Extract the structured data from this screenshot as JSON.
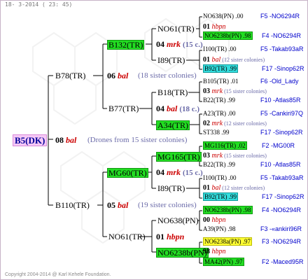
{
  "header": "18- 3-2014 ( 23: 45)",
  "footer": "Copyright 2004-2014 @ Karl Kehele Foundation.",
  "root": {
    "name": "B5(DK)",
    "num": "08",
    "breeder": "bal",
    "note": "(Drones from 15 sister colonies)"
  },
  "g1": {
    "top": "B78(TR)",
    "bottom": "B110(TR)"
  },
  "p_b78": {
    "num": "06",
    "breeder": "bal",
    "note": "(18 sister colonies)"
  },
  "p_b110": {
    "num": "05",
    "breeder": "bal",
    "note": "(19 sister colonies)"
  },
  "g2": {
    "a": "B132(TR)",
    "b": "B77(TR)",
    "c": "MG60(TR)",
    "d": "NO61(TR)"
  },
  "p_b132": {
    "num": "04",
    "breeder": "mrk",
    "note": "(15 c.)"
  },
  "p_b77": {
    "num": "04",
    "breeder": "bal",
    "note": "(18 c.)"
  },
  "p_mg60": {
    "num": "04",
    "breeder": "mrk",
    "note": "(15 c.)"
  },
  "p_no61": {
    "num": "01",
    "breeder": "hbpn"
  },
  "g3": {
    "a": "NO61(TR)",
    "b": "I89(TR)",
    "c": "B18(TR)",
    "d": "A34(TR)",
    "e": "MG165(TR)",
    "f": "I89(TR)",
    "g": "NO638(PN)",
    "h": "NO6238b(PN)"
  },
  "gen4": [
    {
      "kind": "node",
      "label": "NO638(PN) .00",
      "hl": "",
      "ref": "F5 -NO6294R"
    },
    {
      "kind": "pair",
      "num": "01",
      "breeder": "hbpn",
      "note": ""
    },
    {
      "kind": "node",
      "label": "NO6238b(PN) .98",
      "hl": "green",
      "ref": "F4 -NO6294R"
    },
    {
      "kind": "node",
      "label": "I100(TR) .00",
      "hl": "",
      "ref": "F5 -Takab93aR"
    },
    {
      "kind": "pair",
      "num": "01",
      "breeder": "bal",
      "note": "(12 sister colonies)"
    },
    {
      "kind": "node",
      "label": "B92(TR) .99",
      "hl": "cyan",
      "ref": "F17 -Sinop62R"
    },
    {
      "kind": "node",
      "label": "B105(TR) .01",
      "hl": "",
      "ref": "F6 -Old_Lady"
    },
    {
      "kind": "pair",
      "num": "03",
      "breeder": "mrk",
      "note": "(15 sister colonies)"
    },
    {
      "kind": "node",
      "label": "B22(TR) .99",
      "hl": "",
      "ref": "F10 -Atlas85R"
    },
    {
      "kind": "node",
      "label": "A23(TR) .00",
      "hl": "",
      "ref": "F5 -Cankiri97Q"
    },
    {
      "kind": "pair",
      "num": "02",
      "breeder": "mrk",
      "note": "(12 sister colonies)"
    },
    {
      "kind": "node",
      "label": "ST338 .99",
      "hl": "",
      "ref": "F17 -Sinop62R"
    },
    {
      "kind": "node",
      "label": "MG116(TR) .02",
      "hl": "green",
      "ref": "F2 -MG00R"
    },
    {
      "kind": "pair",
      "num": "03",
      "breeder": "mrk",
      "note": "(15 sister colonies)"
    },
    {
      "kind": "node",
      "label": "B22(TR) .99",
      "hl": "",
      "ref": "F10 -Atlas85R"
    },
    {
      "kind": "node",
      "label": "I100(TR) .00",
      "hl": "",
      "ref": "F5 -Takab93aR"
    },
    {
      "kind": "pair",
      "num": "01",
      "breeder": "bal",
      "note": "(12 sister colonies)"
    },
    {
      "kind": "node",
      "label": "B92(TR) .99",
      "hl": "cyan",
      "ref": "F17 -Sinop62R"
    },
    {
      "kind": "node",
      "label": "NO6238b(PN) .98",
      "hl": "green",
      "ref": "F4 -NO6294R"
    },
    {
      "kind": "pair",
      "num": "00",
      "breeder": "hbpn",
      "note": ""
    },
    {
      "kind": "node",
      "label": "A39(PN) .98",
      "hl": "",
      "ref": "F3 -«ankiri96R"
    },
    {
      "kind": "node",
      "label": "NO6238a(PN) .97",
      "hl": "yellow",
      "ref": "F3 -NO6294R"
    },
    {
      "kind": "pair",
      "num": "98",
      "breeder": "hbpn",
      "note": ""
    },
    {
      "kind": "node",
      "label": "MA42(PN) .97",
      "hl": "green",
      "ref": "F2 -Maced95R"
    }
  ]
}
